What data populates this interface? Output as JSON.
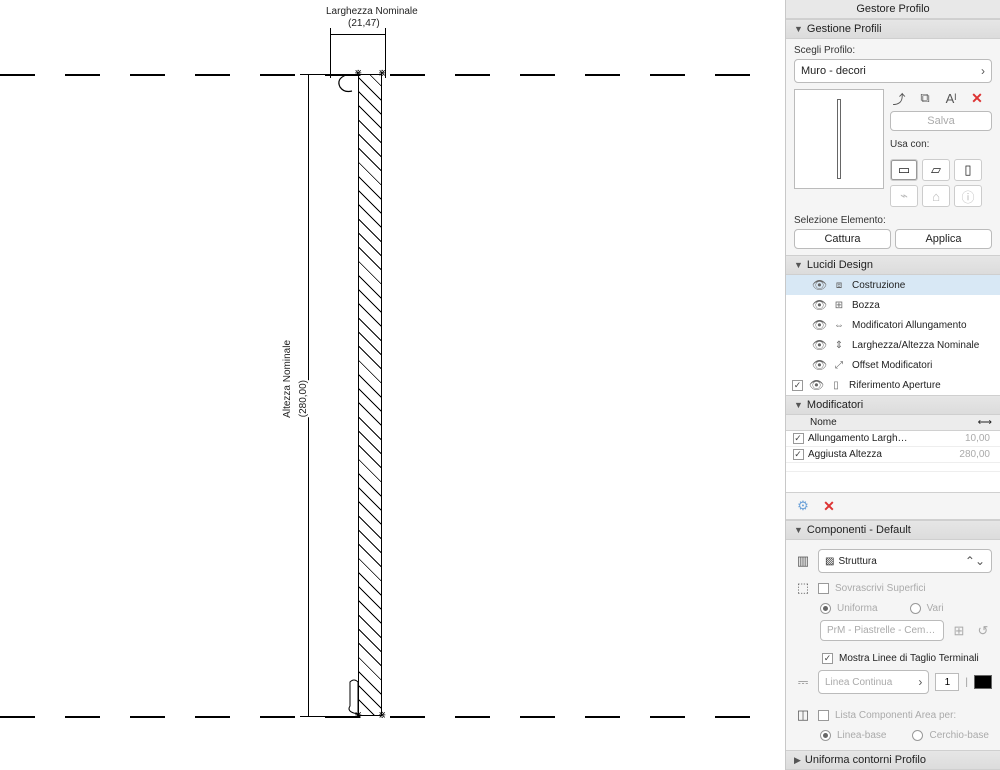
{
  "panel_title": "Gestore Profilo",
  "gestione": {
    "title": "Gestione Profili",
    "choose_label": "Scegli Profilo:",
    "profile_name": "Muro - decori",
    "save_label": "Salva",
    "use_with_label": "Usa con:"
  },
  "selezione": {
    "label": "Selezione Elemento:",
    "capture": "Cattura",
    "apply": "Applica"
  },
  "lucidi": {
    "title": "Lucidi Design",
    "items": [
      {
        "name": "Costruzione",
        "selected": true
      },
      {
        "name": "Bozza",
        "selected": false
      },
      {
        "name": "Modificatori Allungamento",
        "selected": false
      },
      {
        "name": "Larghezza/Altezza Nominale",
        "selected": false
      },
      {
        "name": "Offset Modificatori",
        "selected": false
      },
      {
        "name": "Riferimento Aperture",
        "selected": false,
        "checked": true
      }
    ]
  },
  "modificatori": {
    "title": "Modificatori",
    "col_name": "Nome",
    "rows": [
      {
        "checked": true,
        "name": "Allungamento Largh…",
        "value": "10,00"
      },
      {
        "checked": true,
        "name": "Aggiusta Altezza",
        "value": "280,00"
      }
    ]
  },
  "componenti": {
    "title": "Componenti - Default",
    "struttura": "Struttura",
    "sovrascrivi": "Sovrascrivi Superfici",
    "uniforma": "Uniforma",
    "vari": "Vari",
    "material": "PrM - Piastrelle - Cem…",
    "mostra_linee": "Mostra Linee di Taglio Terminali",
    "linea_continua": "Linea Continua",
    "line_num": "1",
    "lista_componenti": "Lista Componenti Area per:",
    "linea_base": "Linea-base",
    "cerchio_base": "Cerchio-base"
  },
  "uniforma_contorni": "Uniforma contorni Profilo",
  "canvas": {
    "larghezza_label": "Larghezza Nominale",
    "larghezza_value": "(21,47)",
    "altezza_label": "Altezza Nominale",
    "altezza_value": "(280,00)"
  }
}
